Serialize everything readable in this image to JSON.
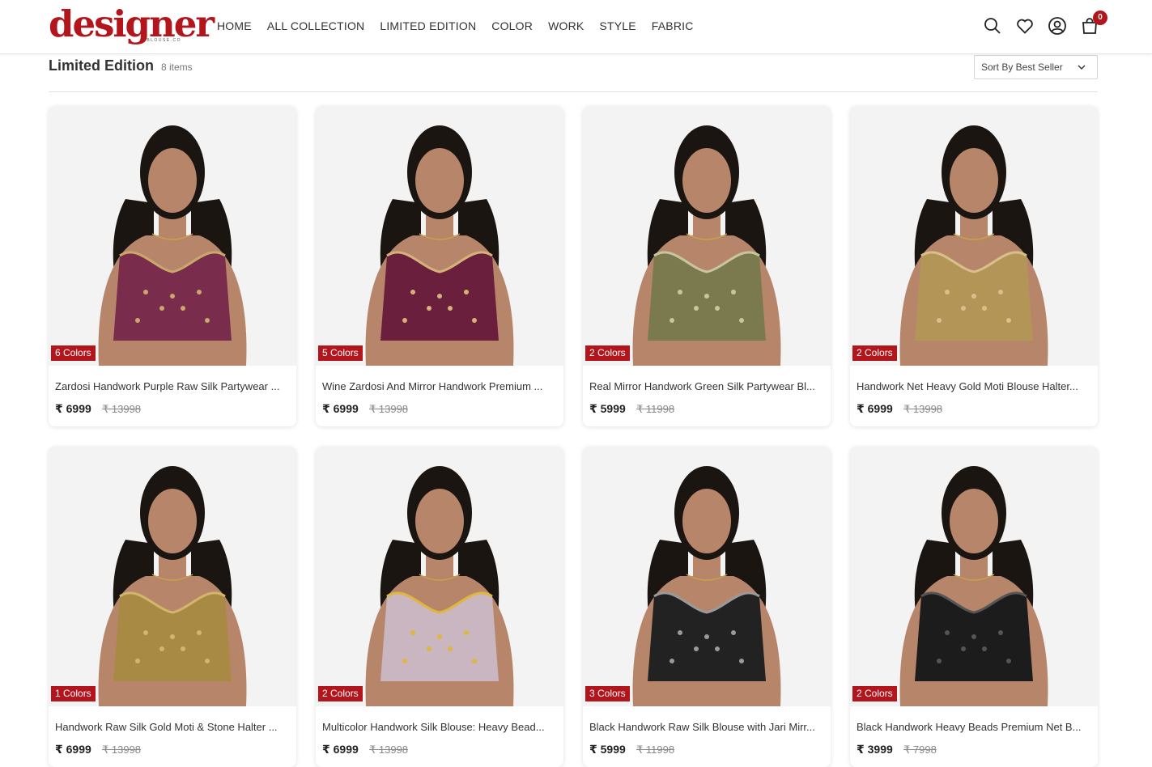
{
  "brand": {
    "name": "designer",
    "tagline": "BLOUSE.CO",
    "accent_color": "#b2151c"
  },
  "nav": {
    "items": [
      {
        "label": "HOME"
      },
      {
        "label": "ALL COLLECTION"
      },
      {
        "label": "LIMITED EDITION"
      },
      {
        "label": "COLOR"
      },
      {
        "label": "WORK"
      },
      {
        "label": "STYLE"
      },
      {
        "label": "FABRIC"
      }
    ]
  },
  "header_icons": {
    "search": "search-icon",
    "wishlist": "heart-icon",
    "account": "user-icon",
    "cart": "bag-icon",
    "cart_count": "0"
  },
  "listing": {
    "title": "Limited Edition",
    "count": "8 items",
    "sort_label": "Sort By Best Seller"
  },
  "products": [
    {
      "name": "Zardosi Handwork Purple Raw Silk Partywear ...",
      "colors": "6 Colors",
      "price": "₹ 6999",
      "mrp": "₹ 13998",
      "garment_color": "#7a2c4c",
      "accent": "#c9a86a"
    },
    {
      "name": "Wine Zardosi And Mirror Handwork Premium ...",
      "colors": "5 Colors",
      "price": "₹ 6999",
      "mrp": "₹ 13998",
      "garment_color": "#6a1f3d",
      "accent": "#d4b37a"
    },
    {
      "name": "Real Mirror Handwork Green Silk Partywear Bl...",
      "colors": "2 Colors",
      "price": "₹ 5999",
      "mrp": "₹ 11998",
      "garment_color": "#7b7a4e",
      "accent": "#c8c6a0"
    },
    {
      "name": "Handwork Net Heavy Gold Moti Blouse Halter...",
      "colors": "2 Colors",
      "price": "₹ 6999",
      "mrp": "₹ 13998",
      "garment_color": "#b49558",
      "accent": "#d8c08a"
    },
    {
      "name": "Handwork Raw Silk Gold Moti & Stone Halter ...",
      "colors": "1 Colors",
      "price": "₹ 6999",
      "mrp": "₹ 13998",
      "garment_color": "#a88a44",
      "accent": "#d1b66c"
    },
    {
      "name": "Multicolor Handwork Silk Blouse: Heavy Bead...",
      "colors": "2 Colors",
      "price": "₹ 6999",
      "mrp": "₹ 13998",
      "garment_color": "#c9b6c0",
      "accent": "#e0b63c"
    },
    {
      "name": "Black Handwork Raw Silk Blouse with Jari Mirr...",
      "colors": "3 Colors",
      "price": "₹ 5999",
      "mrp": "₹ 11998",
      "garment_color": "#222222",
      "accent": "#9a9a9a"
    },
    {
      "name": "Black Handwork Heavy Beads Premium Net B...",
      "colors": "2 Colors",
      "price": "₹ 3999",
      "mrp": "₹ 7998",
      "garment_color": "#1c1c1c",
      "accent": "#555555"
    }
  ]
}
